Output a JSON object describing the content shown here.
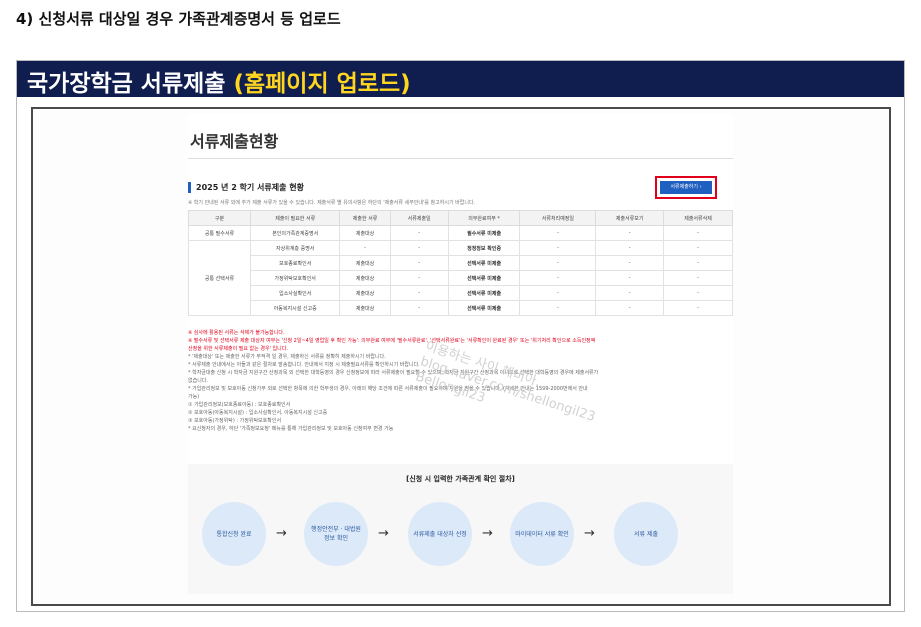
{
  "step_heading": "4) 신청서류 대상일 경우 가족관계증명서 등 업로드",
  "banner": {
    "title_main": "국가장학금 서류제출 ",
    "title_accent": "(홈페이지 업로드)"
  },
  "page": {
    "title": "서류제출현황",
    "section_title": "2025 년 2 학기 서류제출 현황",
    "section_note": "※ 학기 안내된 서류 외에 추가 제출 서류가 있을 수 있습니다. 제출서류 별 유의사항은 하단의 '제출서류 세부안내'를 참고하시기 바랍니다.",
    "submit_button": "서류제출하기 ›"
  },
  "table": {
    "headers": [
      "구분",
      "제출이 필요한 서류",
      "제출한 서류",
      "서류제출일",
      "의무완료여부 *",
      "서류처리예정일",
      "제출서류보기",
      "제출서류삭제"
    ],
    "rows": [
      [
        "공통 필수서류",
        "본인의가족관계증명서",
        "제출대상",
        "-",
        "필수서류 미제출",
        "-",
        "-",
        "-"
      ],
      [
        "",
        "자상위계층 증명서",
        "-",
        "-",
        "정정정보 확인중",
        "-",
        "-",
        "-"
      ],
      [
        "",
        "보호종료확인서",
        "제출대상",
        "-",
        "선택서류 미제출",
        "-",
        "-",
        "-"
      ],
      [
        "공통 선택서류",
        "가정위탁보호확인서",
        "제출대상",
        "-",
        "선택서류 미제출",
        "-",
        "-",
        "-"
      ],
      [
        "",
        "입소사실확인서",
        "제출대상",
        "-",
        "선택서류 미제출",
        "-",
        "-",
        "-"
      ],
      [
        "",
        "아동복지시설 신고증",
        "제출대상",
        "-",
        "선택서류 미제출",
        "-",
        "-",
        "-"
      ]
    ]
  },
  "notes": [
    {
      "text": "※ 심사에 활용된 서류는 삭제가 불가능합니다.",
      "red": true
    },
    {
      "text": "※ 필수서류 및 선택서류 제출 대상자 여부는 '신청 2일~4일 영업일 후 확인 가능'. 의무완료 여부에 '필수서류완료', '선택서류완료'는 '서류확인이 완료된 경우' 또는 '위기처리 확인으로 소득인정액",
      "red": true
    },
    {
      "text": "   산정을 위한 서류제출이 필요 없는 경우' 입니다.",
      "red": true
    },
    {
      "text": "* '제출대상' 또는 제출한 서류가 부적격 일 경우, 제출하신 서류를 정확히 제출하시기 바랍니다.",
      "red": false
    },
    {
      "text": "* 서류제출 안내에서는 아들과 같은 절차로 발송합니다. 안내에서 지정 시 제출필요서류를 확인하시기 바랍니다.",
      "red": false
    },
    {
      "text": "* 학자금대출 신청 시 학자금 지원구간 산정과목 외 선택한 대학등영의 경우 신청정보에 따라 서류제출이 필요할 수 있으며, 학자금 지원구간 산정과목 아니오로 선택한 대학등영의 경우에 제출서류가",
      "red": false
    },
    {
      "text": "  없습니다.",
      "red": false
    },
    {
      "text": "* 가입관리정보 및 보호아동 신청가부 외로 선택한 항목에 의한 학부생의 경우, 아래의 해당 조건에 따른 서류제출이 필요하며 지원을 받을 수 있습니다. (자세한 안내는 1599-2000번에서 안내",
      "red": false
    },
    {
      "text": "  가능)",
      "red": false
    },
    {
      "text": "   ① 가입관리정보(보호종료아동) : 보호종료확인서",
      "red": false
    },
    {
      "text": "   ② 보호아동(아동복지시설) : 입소사실확인서, 아동복지시설 신고증",
      "red": false
    },
    {
      "text": "   ③ 보호아동(가정위탁) : 가정위탁보호확인서",
      "red": false
    },
    {
      "text": "   * 요신청자의 경우, 하단 '가족정보요청' 메뉴를 통해 가입관리정보 및 보호아동 신청여부 변경 가능",
      "red": false
    }
  ],
  "watermark": [
    "이용하는 사이 해비아...",
    "blog.naver.com/shellongil23",
    "Bellongil23"
  ],
  "process": {
    "title": "[신청 시 입력한 가족관계 확인 절차]",
    "steps": [
      "통합신청 완료",
      "행정안전부 · 대법원 정보 확인",
      "서류제출 대상자 선정",
      "마이데이터 서류 확인",
      "서류 제출"
    ],
    "arrow": "→"
  }
}
